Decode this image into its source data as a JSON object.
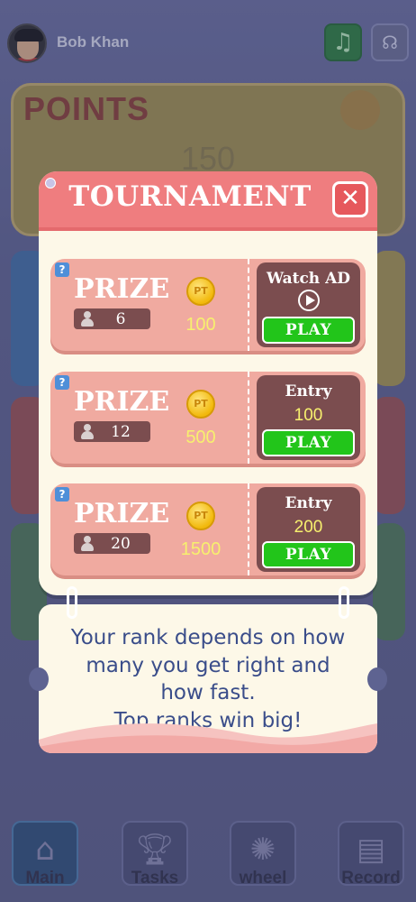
{
  "user": {
    "name": "Bob Khan"
  },
  "background": {
    "points_label": "POINTS",
    "points_value": "150",
    "icons": {
      "music": "music-icon",
      "support": "headset-icon"
    }
  },
  "nav": [
    {
      "label": "Main",
      "icon": "home-icon",
      "active": true
    },
    {
      "label": "Tasks",
      "icon": "trophy-icon",
      "active": false
    },
    {
      "label": "wheel",
      "icon": "wheel-icon",
      "active": false
    },
    {
      "label": "Record",
      "icon": "clipboard-icon",
      "active": false
    }
  ],
  "modal": {
    "title": "TOURNAMENT",
    "close_icon": "close-icon",
    "rows": [
      {
        "prize_label": "PRIZE",
        "players": "6",
        "coin_label": "PT",
        "prize": "100",
        "action_type": "watch",
        "action_label": "Watch AD",
        "entry_value": "",
        "play_label": "PLAY"
      },
      {
        "prize_label": "PRIZE",
        "players": "12",
        "coin_label": "PT",
        "prize": "500",
        "action_type": "entry",
        "action_label": "Entry",
        "entry_value": "100",
        "play_label": "PLAY"
      },
      {
        "prize_label": "PRIZE",
        "players": "20",
        "coin_label": "PT",
        "prize": "1500",
        "action_type": "entry",
        "action_label": "Entry",
        "entry_value": "200",
        "play_label": "PLAY"
      }
    ]
  },
  "info": {
    "lines": [
      "Your rank depends on how",
      "many you get right and",
      "how fast.",
      "Top ranks win big!"
    ]
  },
  "colors": {
    "header": "#ef7d7f",
    "ticket": "#f0aaa0",
    "ticket_dark": "#7b4d4f",
    "play_button": "#22c51a",
    "info_text": "#3a4d8a"
  }
}
